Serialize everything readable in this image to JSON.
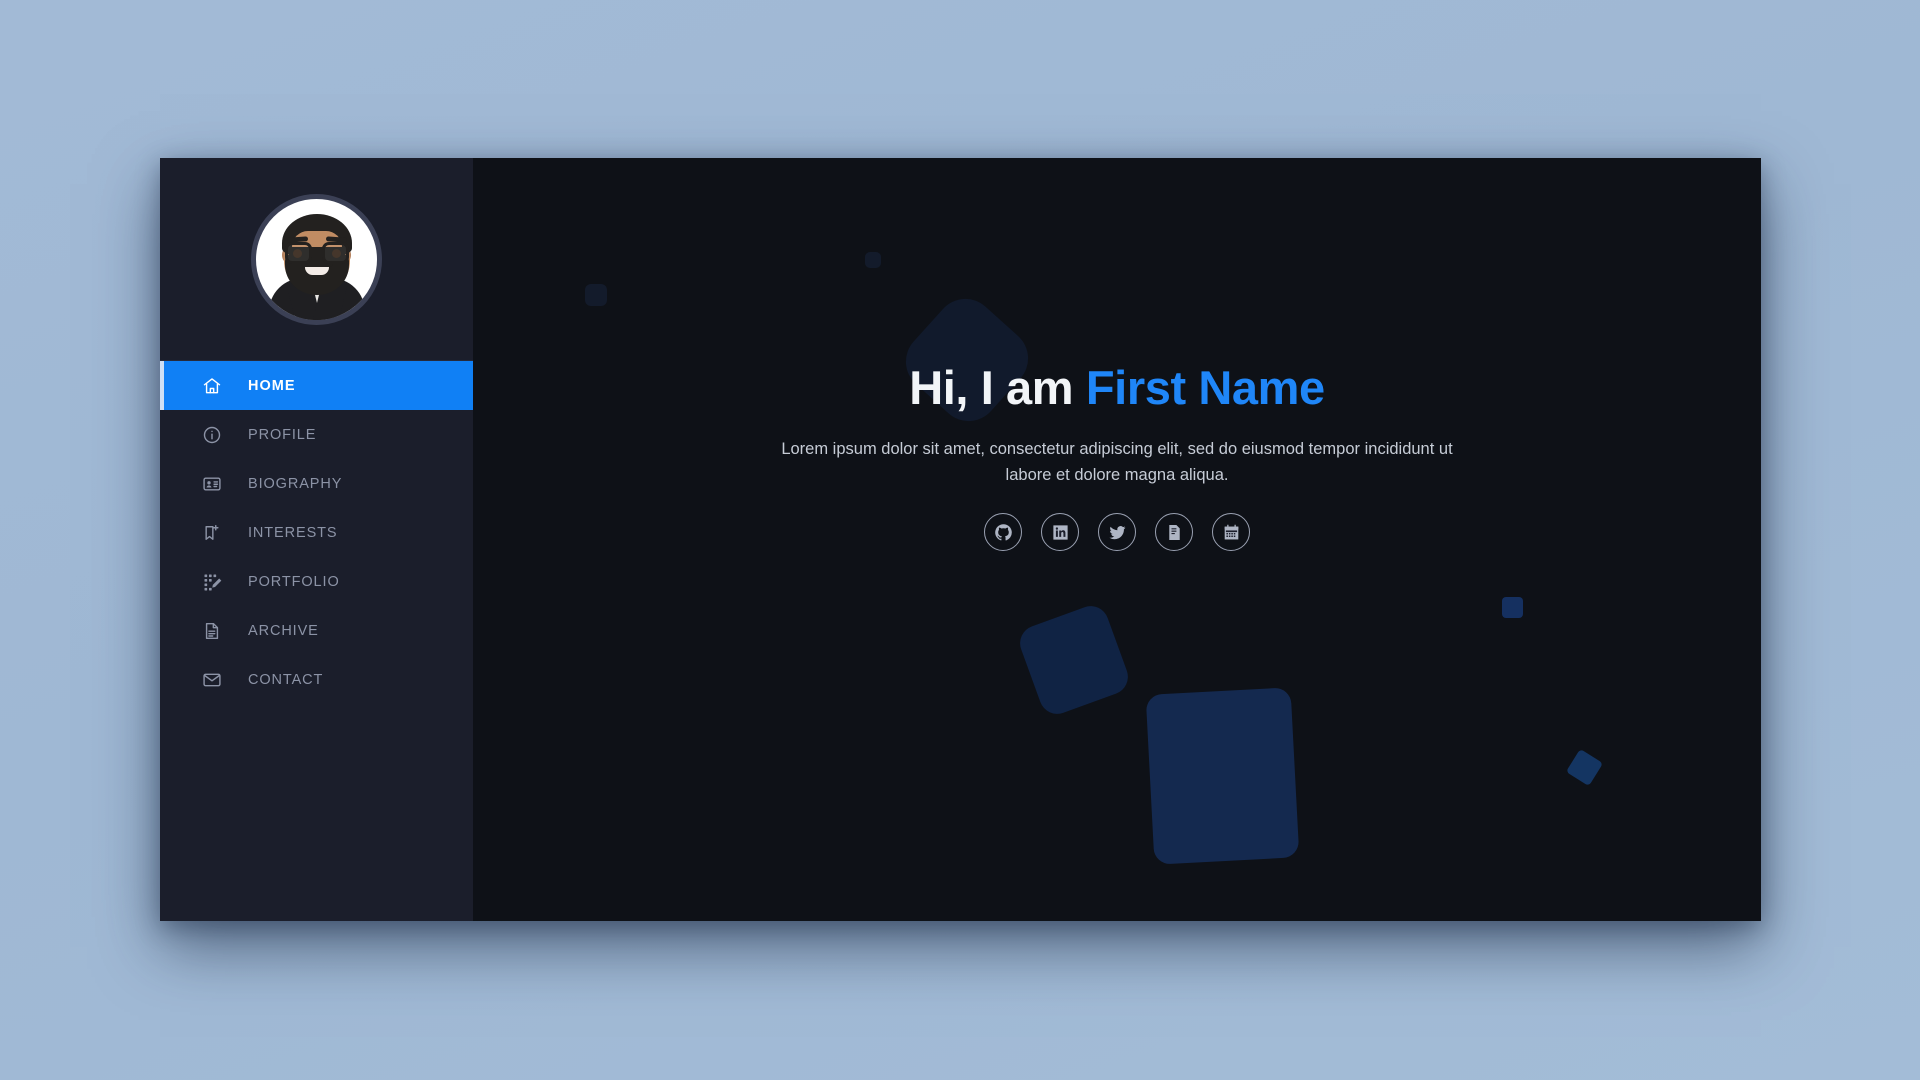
{
  "theme": {
    "page_background": "#9fb8d4",
    "sidebar_background": "#1b1e2b",
    "main_background": "#0e1117",
    "accent_blue": "#1080f5",
    "heading_accent": "#1f86f8",
    "muted_text": "#8c93a6",
    "decor_shape": "#14294f"
  },
  "sidebar": {
    "avatar": {
      "icon": "avatar-memoji",
      "alt": "Profile avatar illustration"
    },
    "nav": [
      {
        "id": "home",
        "label": "HOME",
        "icon": "home-icon",
        "active": true
      },
      {
        "id": "profile",
        "label": "PROFILE",
        "icon": "info-circle-icon",
        "active": false
      },
      {
        "id": "biography",
        "label": "BIOGRAPHY",
        "icon": "id-card-icon",
        "active": false
      },
      {
        "id": "interests",
        "label": "INTERESTS",
        "icon": "bookmark-plus-icon",
        "active": false
      },
      {
        "id": "portfolio",
        "label": "PORTFOLIO",
        "icon": "grid-pencil-icon",
        "active": false
      },
      {
        "id": "archive",
        "label": "ARCHIVE",
        "icon": "document-icon",
        "active": false
      },
      {
        "id": "contact",
        "label": "CONTACT",
        "icon": "envelope-icon",
        "active": false
      }
    ]
  },
  "hero": {
    "greeting": "Hi, I am",
    "name": "First Name",
    "subtitle": "Lorem ipsum dolor sit amet, consectetur adipiscing elit, sed do eiusmod tempor incididunt ut labore et dolore magna aliqua.",
    "socials": [
      {
        "id": "github",
        "label": "GitHub",
        "icon": "github-icon"
      },
      {
        "id": "linkedin",
        "label": "LinkedIn",
        "icon": "linkedin-icon"
      },
      {
        "id": "twitter",
        "label": "Twitter",
        "icon": "twitter-icon"
      },
      {
        "id": "cv",
        "label": "CV",
        "icon": "document-text-icon"
      },
      {
        "id": "calendar",
        "label": "Calendar",
        "icon": "calendar-icon"
      }
    ]
  }
}
